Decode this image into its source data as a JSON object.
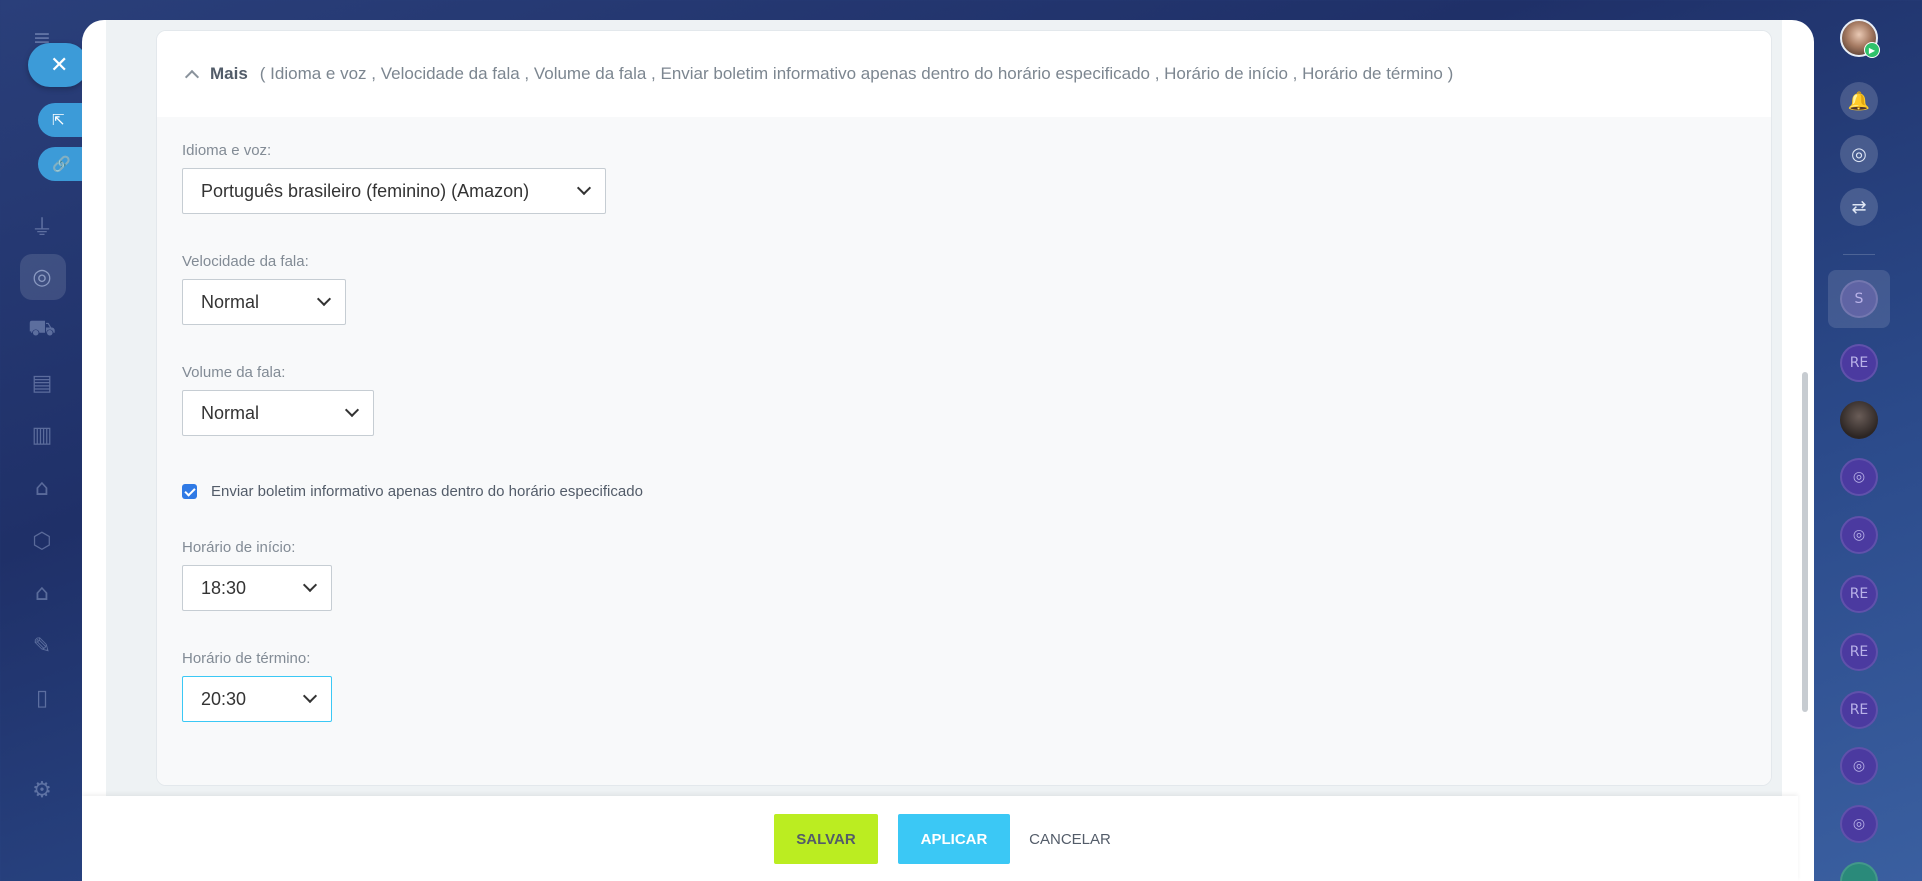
{
  "left_sidebar": {
    "icons": [
      "menu-icon",
      "house-icon",
      "inbox-icon",
      "funnel-icon",
      "target-icon",
      "cart-icon",
      "contact-card-icon",
      "bar-chart-icon",
      "robot-icon",
      "box-icon",
      "warehouse-icon",
      "pen-icon",
      "document-icon",
      "gear-icon"
    ]
  },
  "section": {
    "title": "Mais",
    "summary": "( Idioma e voz ,  Velocidade da fala ,  Volume da fala ,  Enviar boletim informativo apenas dentro do horário especificado ,  Horário de início ,  Horário de término  )"
  },
  "fields": {
    "language": {
      "label": "Idioma e voz:",
      "value": "Português brasileiro (feminino) (Amazon)"
    },
    "speed": {
      "label": "Velocidade da fala:",
      "value": "Normal"
    },
    "volume": {
      "label": "Volume da fala:",
      "value": "Normal"
    },
    "only_in_hours": {
      "label": "Enviar boletim informativo apenas dentro do horário especificado",
      "checked": true
    },
    "start_time": {
      "label": "Horário de início:",
      "value": "18:30"
    },
    "end_time": {
      "label": "Horário de término:",
      "value": "20:30"
    }
  },
  "footer": {
    "save": "SALVAR",
    "apply": "APLICAR",
    "cancel": "CANCELAR"
  },
  "right_sidebar": {
    "chat_initials": [
      "S",
      "RE",
      "RE",
      "RE",
      "RE"
    ]
  },
  "colors": {
    "save_button": "#bbed21",
    "apply_button": "#3bc8f5",
    "checkbox": "#2f7ae5",
    "sidebar_accent": "#3c9bd8"
  }
}
